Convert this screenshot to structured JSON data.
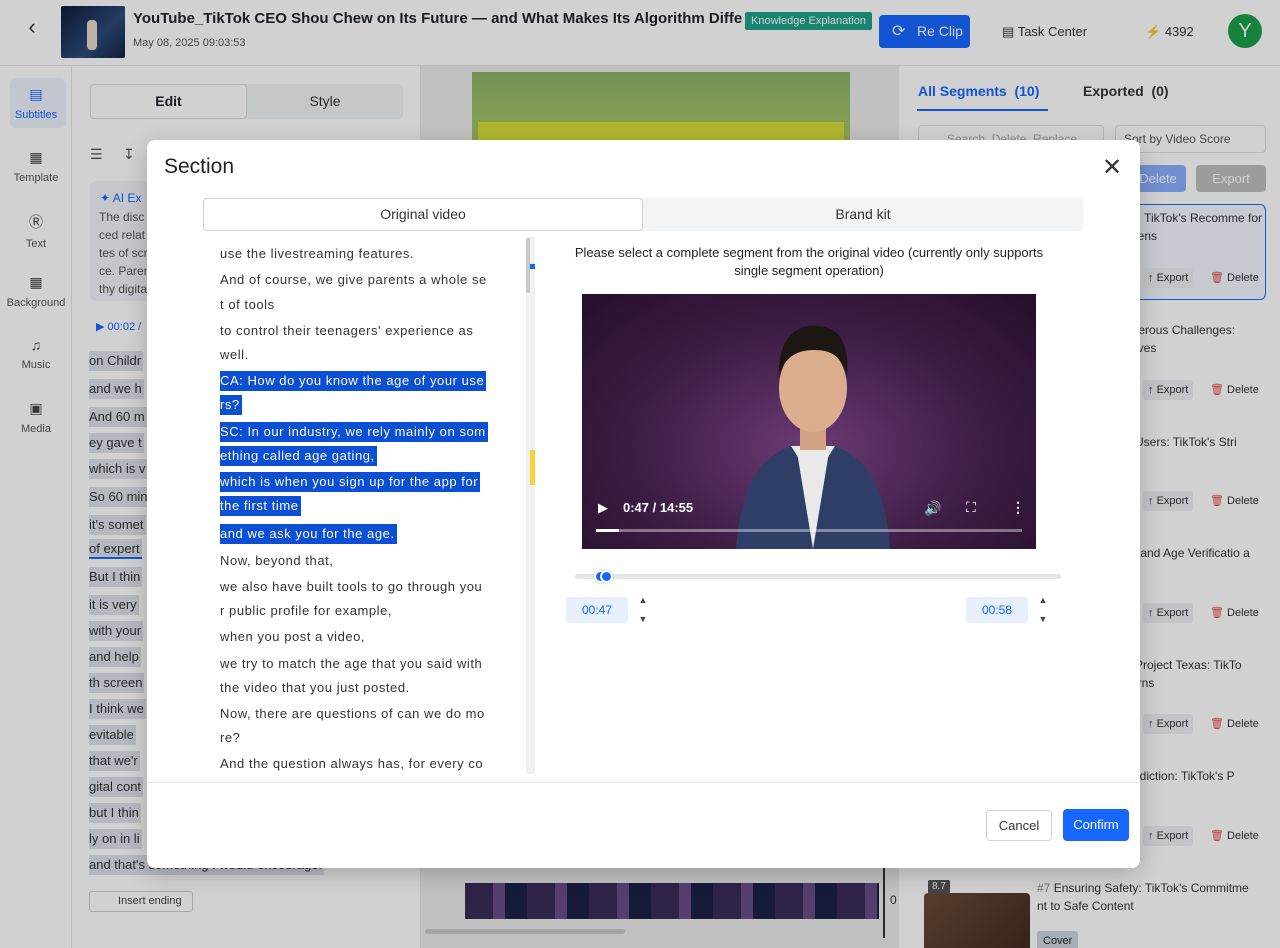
{
  "header": {
    "title": "YouTube_TikTok CEO Shou Chew on Its Future — and What Makes Its Algorithm Different ...",
    "date": "May 08, 2025 09:03:53",
    "tag": "Knowledge Explanation",
    "reclip_label": "Re Clip",
    "task_center_label": "Task Center",
    "credits": "4392",
    "avatar_letter": "Y"
  },
  "rail": {
    "items": [
      {
        "label": "Subtitles",
        "icon": "subtitles-icon"
      },
      {
        "label": "Template",
        "icon": "template-icon"
      },
      {
        "label": "Text",
        "icon": "text-icon"
      },
      {
        "label": "Background",
        "icon": "background-icon"
      },
      {
        "label": "Music",
        "icon": "music-icon"
      },
      {
        "label": "Media",
        "icon": "media-icon"
      }
    ]
  },
  "left_panel": {
    "tabs": [
      "Edit",
      "Style"
    ],
    "ai_title": "AI Ex",
    "ai_lines": [
      "The disc",
      "ced relat",
      "tes of scr",
      "ce. Paren",
      "thy digita"
    ],
    "time_chip": "00:02 /",
    "subtitle_lines": [
      "on Childr",
      "and we h",
      "And 60 m",
      "ey gave t",
      "which is v",
      "So 60 min",
      "it's somet",
      "of expert",
      "But I thin",
      "it is very",
      "with your",
      "and help",
      "th screen",
      "I think we",
      "evitable",
      "that we'r",
      "gital cont",
      "but I thin",
      "ly on in li",
      "and that's something I would encourage."
    ],
    "insert_ending_label": "Insert ending"
  },
  "right_panel": {
    "tab_all": "All Segments",
    "tab_all_count": "(10)",
    "tab_exported": "Exported",
    "tab_exported_count": "(0)",
    "search_placeholder": "Search, Delete, Replace",
    "sort_label": "Sort by Video Score",
    "delete_label": "Delete",
    "export_label": "Export",
    "segments": [
      {
        "title": "ay: TikTok's Recomme for Teens"
      },
      {
        "title": "ngerous Challenges: atives"
      },
      {
        "title": "g Users: TikTok's Stri"
      },
      {
        "title": "cy and Age Verificatio a"
      },
      {
        "title": "d Project Texas: TikTo cerns"
      },
      {
        "title": "Addiction: TikTok's P"
      }
    ],
    "seg_export_label": "Export",
    "seg_delete_label": "Delete",
    "seg7": {
      "number": "#7",
      "title": "Ensuring Safety: TikTok's Commitme nt to Safe Content",
      "score": "8.7",
      "cover_label": "Cover"
    }
  },
  "timeline": {
    "marker": "0"
  },
  "modal": {
    "title": "Section",
    "tabs": {
      "original": "Original video",
      "brand": "Brand kit"
    },
    "instruction": "Please select a complete segment from the original video (currently only supports single segment operation)",
    "transcript": [
      {
        "text": "use the livestreaming features.",
        "sel": false
      },
      {
        "text": "And of course, we give parents a whole se",
        "sel": false
      },
      {
        "text": "t of tools",
        "sel": false
      },
      {
        "text": "to control their teenagers' experience as",
        "sel": false
      },
      {
        "text": "well.",
        "sel": false
      },
      {
        "text": "CA: How do you know the age of your use",
        "sel": true
      },
      {
        "text": "rs?",
        "sel": true
      },
      {
        "text": "SC: In our industry, we rely mainly on som",
        "sel": true
      },
      {
        "text": "ething called age gating,",
        "sel": true
      },
      {
        "text": "which is when you sign up for the app for",
        "sel": true
      },
      {
        "text": "the first time",
        "sel": true
      },
      {
        "text": "and we ask you for the age.",
        "sel": true
      },
      {
        "text": "Now, beyond that,",
        "sel": false
      },
      {
        "text": "we also have built tools to go through you",
        "sel": false
      },
      {
        "text": "r public profile for example,",
        "sel": false
      },
      {
        "text": "when you post a video,",
        "sel": false
      },
      {
        "text": "we try to match the age that you said with",
        "sel": false
      },
      {
        "text": "the video that you just posted.",
        "sel": false
      },
      {
        "text": "Now, there are questions of can we do mo",
        "sel": false
      },
      {
        "text": "re?",
        "sel": false
      },
      {
        "text": "And the question always has, for every co",
        "sel": false
      }
    ],
    "video": {
      "current_time": "0:47 / 14:55",
      "progress": 0.054
    },
    "range": {
      "start": "00:47",
      "end": "00:58"
    },
    "cancel_label": "Cancel",
    "confirm_label": "Confirm"
  },
  "colors": {
    "accent": "#1667ff",
    "selection": "#0a4fd4",
    "tag": "#1fa18a",
    "avatar": "#1ba04a"
  }
}
